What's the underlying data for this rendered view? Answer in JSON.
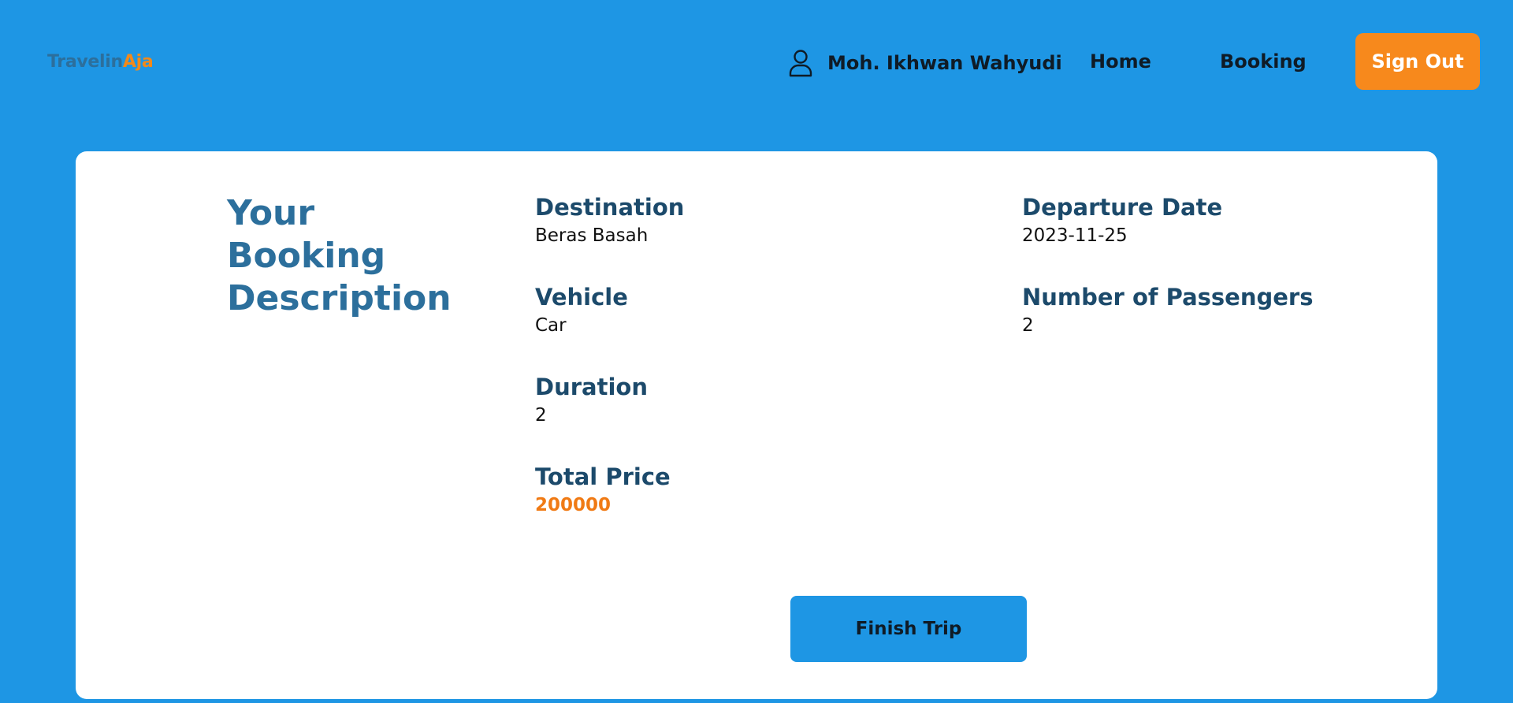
{
  "brand": {
    "part1": "Travelin",
    "part2": "Aja",
    "color1": "#2c6f9c",
    "color2": "#f2891a"
  },
  "nav": {
    "user_icon": "user-icon",
    "user_name": "Moh. Ikhwan Wahyudi",
    "home": "Home",
    "booking": "Booking",
    "sign_out": "Sign Out"
  },
  "card": {
    "title": "Your Booking Description",
    "fields": [
      {
        "label": "Destination",
        "value": "Beras Basah"
      },
      {
        "label": "Departure Date",
        "value": "2023-11-25"
      },
      {
        "label": "Vehicle",
        "value": "Car"
      },
      {
        "label": "Number of Passengers",
        "value": "2"
      },
      {
        "label": "Duration",
        "value": "2"
      },
      {
        "label": "Total Price",
        "value": "200000"
      }
    ],
    "finish_button": "Finish Trip"
  },
  "colors": {
    "background": "#1e96e4",
    "accent": "#f7891c",
    "price": "#f07a14"
  }
}
